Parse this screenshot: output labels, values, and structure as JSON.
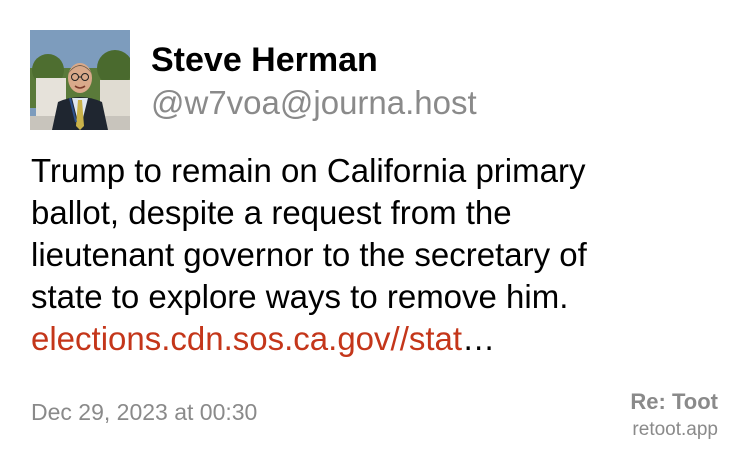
{
  "post": {
    "author_name": "Steve Herman",
    "author_handle": "@w7voa@journa.host",
    "avatar_icon": "profile-photo",
    "body_lines": [
      "Trump to remain on California primary",
      "ballot, despite a request from the",
      "lieutenant governor to the secretary of",
      "state to explore ways to remove him."
    ],
    "link_text": "elections.cdn.sos.ca.gov//stat",
    "link_ellipsis": "…",
    "timestamp": "Dec 29, 2023 at 00:30"
  },
  "branding": {
    "title": "Re: Toot",
    "site": "retoot.app"
  },
  "colors": {
    "link": "#c4361a",
    "muted": "#8a8a8a",
    "text": "#000000",
    "background": "#ffffff"
  }
}
